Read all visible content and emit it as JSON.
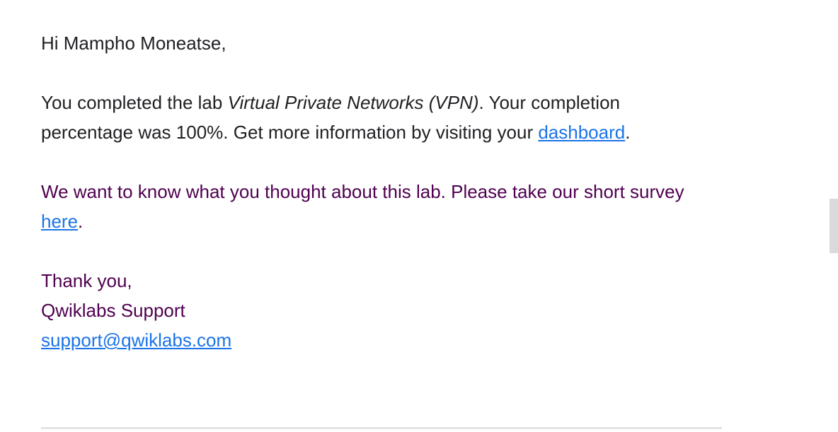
{
  "email": {
    "greeting": "Hi Mampho Moneatse,",
    "completion": {
      "prefix": "You completed the lab ",
      "lab_name": "Virtual Private Networks (VPN)",
      "middle": ". Your completion percentage was 100%. Get more information by visiting your ",
      "dashboard_link": "dashboard",
      "suffix": "."
    },
    "survey": {
      "text": "We want to know what you thought about this lab. Please take our short survey ",
      "link": "here",
      "suffix": "."
    },
    "signoff": {
      "thanks": "Thank you,",
      "team": "Qwiklabs Support",
      "email_link": "support@qwiklabs.com"
    }
  },
  "colors": {
    "text": "#202124",
    "quoted_text": "#500050",
    "link": "#1a73e8"
  }
}
